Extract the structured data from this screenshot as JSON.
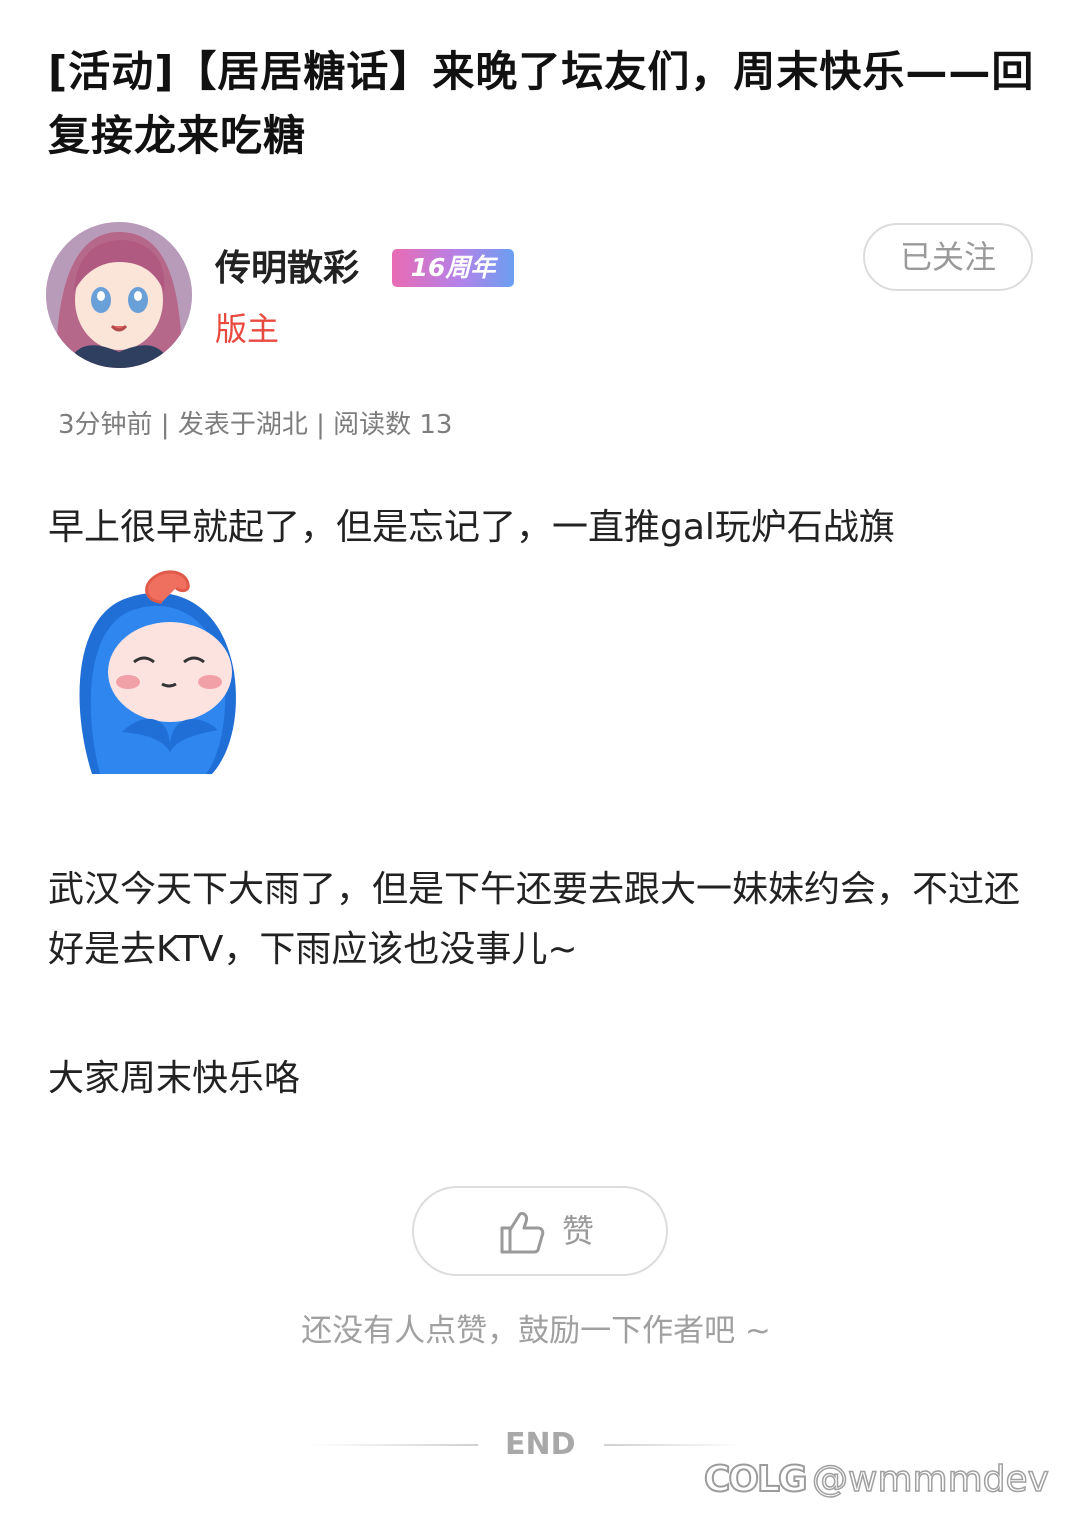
{
  "post": {
    "title": "[活动]【居居糖话】来晚了坛友们，周末快乐——回复接龙来吃糖",
    "meta": "3分钟前 | 发表于湖北 | 阅读数 13",
    "paragraphs": [
      "早上很早就起了，但是忘记了，一直推gal玩炉石战旗",
      "武汉今天下大雨了，但是下午还要去跟大一妹妹约会，不过还好是去KTV，下雨应该也没事儿~",
      "大家周末快乐咯"
    ]
  },
  "author": {
    "name": "传明散彩",
    "badge": "16周年",
    "role": "版主",
    "follow_label": "已关注"
  },
  "actions": {
    "like_label": "赞",
    "like_empty_hint": "还没有人点赞，鼓励一下作者吧 ~",
    "end_label": "END"
  },
  "watermark": {
    "logo": "COLG",
    "handle": "@wmmmdev"
  },
  "colors": {
    "role": "#e84a3f",
    "badge_gradient": [
      "#e86bb3",
      "#b482e8",
      "#6a9ff0"
    ],
    "muted": "#9a9a9a"
  },
  "icons": [
    "thumbs-up-icon",
    "author-avatar",
    "sticker-emoji"
  ]
}
